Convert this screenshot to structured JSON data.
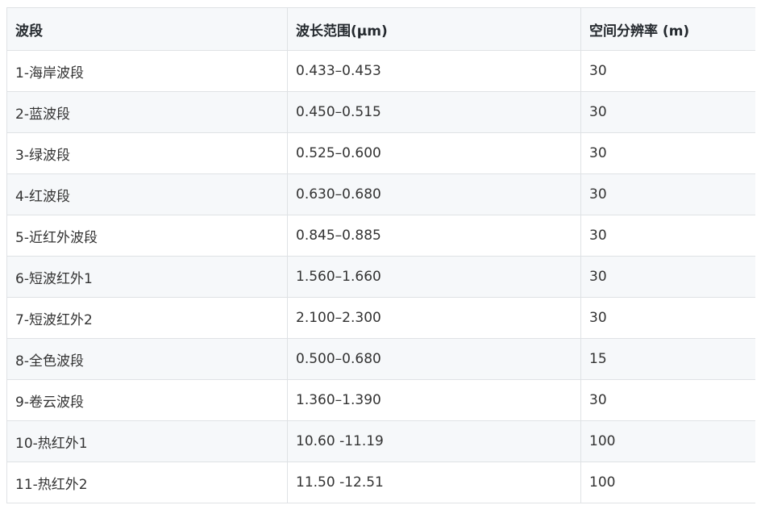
{
  "table": {
    "headers": [
      "波段",
      "波长范围(μm)",
      "空间分辨率 (m)"
    ],
    "rows": [
      [
        "1-海岸波段",
        "0.433–0.453",
        "30"
      ],
      [
        "2-蓝波段",
        "0.450–0.515",
        "30"
      ],
      [
        "3-绿波段",
        "0.525–0.600",
        "30"
      ],
      [
        "4-红波段",
        "0.630–0.680",
        "30"
      ],
      [
        "5-近红外波段",
        "0.845–0.885",
        "30"
      ],
      [
        "6-短波红外1",
        "1.560–1.660",
        "30"
      ],
      [
        "7-短波红外2",
        "2.100–2.300",
        "30"
      ],
      [
        "8-全色波段",
        "0.500–0.680",
        "15"
      ],
      [
        "9-卷云波段",
        "1.360–1.390",
        "30"
      ],
      [
        "10-热红外1",
        "10.60 -11.19",
        "100"
      ],
      [
        "11-热红外2",
        "11.50 -12.51",
        "100"
      ]
    ]
  }
}
